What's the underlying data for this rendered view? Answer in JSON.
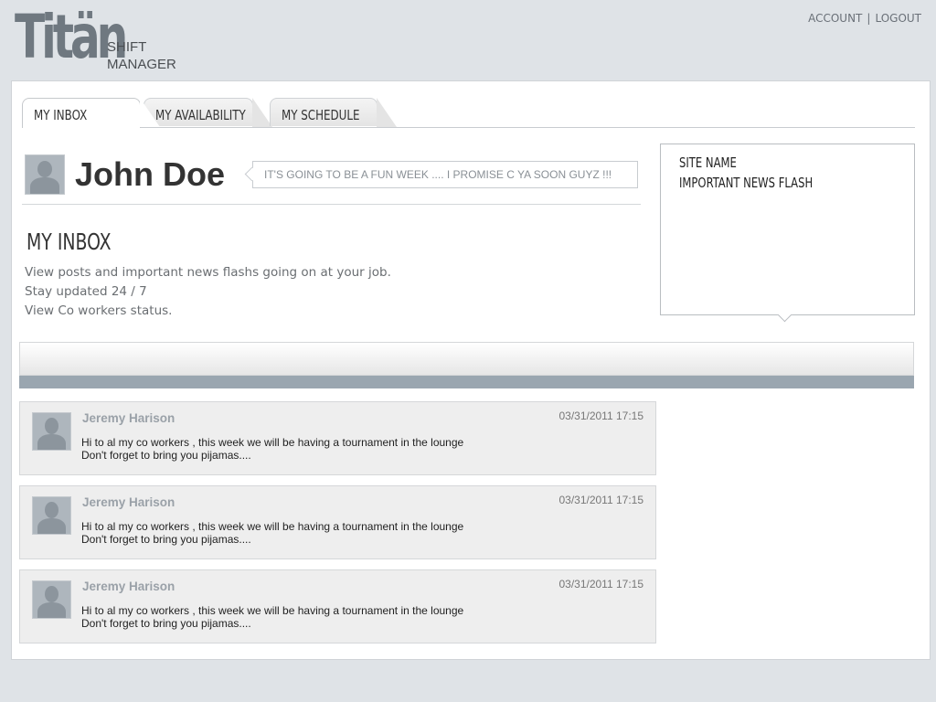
{
  "brand": {
    "logo_text": "Titän",
    "subtitle_line1": "SHIFT",
    "subtitle_line2": "MANAGER"
  },
  "top_links": {
    "account": "ACCOUNT",
    "separator": "|",
    "logout": "LOGOUT"
  },
  "tabs": [
    {
      "label": "MY INBOX",
      "active": true
    },
    {
      "label": "MY AVAILABILITY",
      "active": false
    },
    {
      "label": "MY SCHEDULE",
      "active": false
    }
  ],
  "profile": {
    "name": "John Doe",
    "status": "IT'S GOING TO BE A FUN WEEK .... I PROMISE C YA SOON GUYZ !!!"
  },
  "inbox": {
    "title": "MY INBOX",
    "description": [
      "View posts and important news flashs going on at your job.",
      "Stay updated 24 / 7",
      "View Co workers status."
    ]
  },
  "news": {
    "site_name": "SITE NAME",
    "flash": "IMPORTANT NEWS FLASH"
  },
  "messages": [
    {
      "author": "Jeremy Harison",
      "date": "03/31/2011  17:15",
      "line1": "Hi to al my co workers , this week we will be having a tournament in the lounge",
      "line2": "Don't forget to bring you pijamas...."
    },
    {
      "author": "Jeremy Harison",
      "date": "03/31/2011  17:15",
      "line1": "Hi to al my co workers , this week we will be having a tournament in the lounge",
      "line2": "Don't forget to bring you pijamas...."
    },
    {
      "author": "Jeremy Harison",
      "date": "03/31/2011  17:15",
      "line1": "Hi to al my co workers , this week we will be having a tournament in the lounge",
      "line2": "Don't forget to bring you pijamas...."
    }
  ],
  "colors": {
    "background": "#dfe3e7",
    "accent_strip": "#9aa6b0",
    "author": "#9aa1a8",
    "message_bg": "#eeeeee"
  }
}
